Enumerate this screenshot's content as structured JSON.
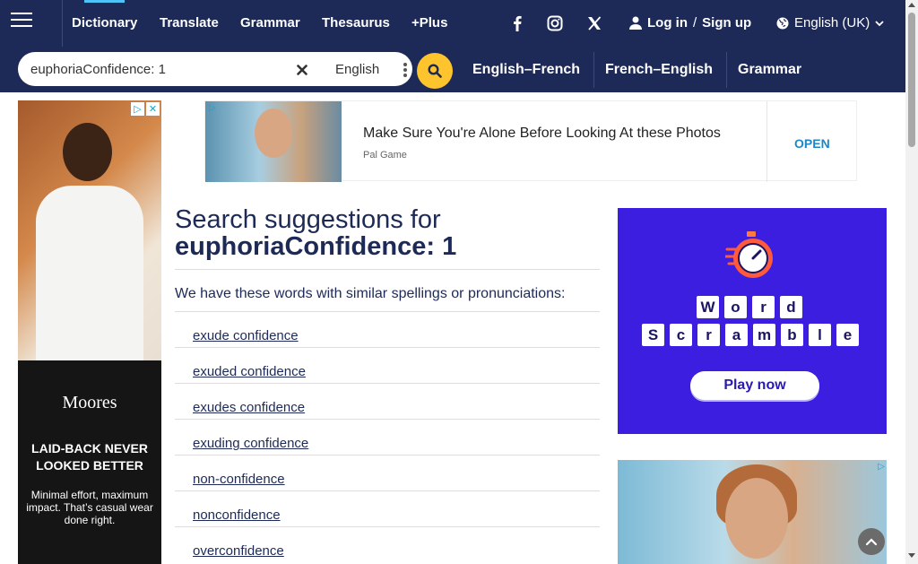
{
  "nav": {
    "items": [
      {
        "label": "Dictionary",
        "active": true
      },
      {
        "label": "Translate"
      },
      {
        "label": "Grammar"
      },
      {
        "label": "Thesaurus"
      },
      {
        "label": "+Plus"
      }
    ],
    "social": [
      "facebook-icon",
      "instagram-icon",
      "x-icon"
    ],
    "login": {
      "log_in": "Log in",
      "separator": "/",
      "sign_up": "Sign up"
    },
    "language": "English (UK)"
  },
  "search": {
    "value": "euphoriaConfidence: 1",
    "dictionary": "English",
    "quick_links": [
      "English–French",
      "French–English",
      "Grammar"
    ]
  },
  "banner_ad": {
    "title": "Make Sure You're Alone Before Looking At these Photos",
    "source": "Pal Game",
    "cta": "OPEN"
  },
  "left_ad": {
    "brand": "Moores",
    "headline": "LAID-BACK NEVER LOOKED BETTER",
    "sub": "Minimal effort, maximum impact. That’s casual wear done right."
  },
  "main": {
    "heading": "Search suggestions for",
    "term": "euphoriaConfidence: 1",
    "intro": "We have these words with similar spellings or pronunciations:",
    "suggestions": [
      "exude confidence",
      "exuded confidence",
      "exudes confidence",
      "exuding confidence",
      "non-confidence",
      "nonconfidence",
      "overconfidence"
    ]
  },
  "word_ad": {
    "row1": [
      "W",
      "o",
      "r",
      "d"
    ],
    "row2": [
      "S",
      "c",
      "r",
      "a",
      "m",
      "b",
      "l",
      "e"
    ],
    "cta": "Play now"
  },
  "colors": {
    "nav_bg": "#1d2a57",
    "search_btn": "#fec42d",
    "word_ad_bg": "#3b1ee0"
  }
}
